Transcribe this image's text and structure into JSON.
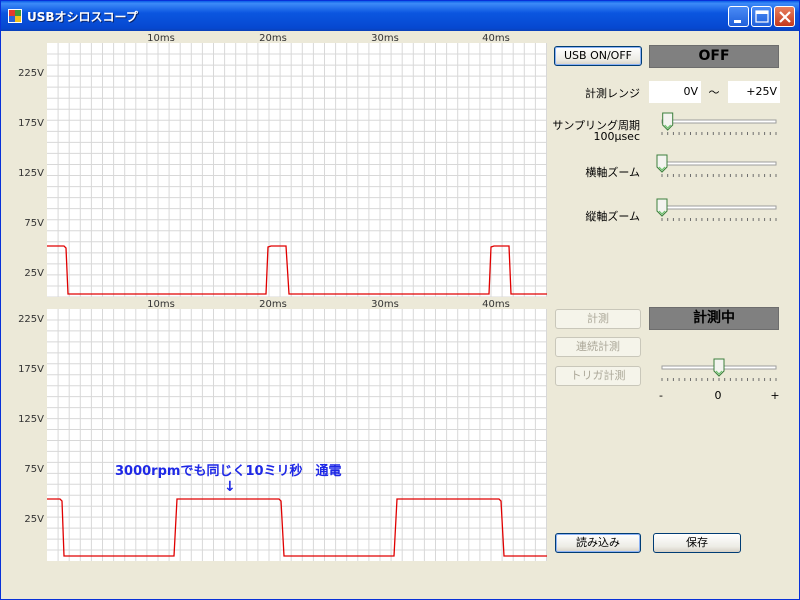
{
  "window": {
    "title": "USBオシロスコープ",
    "title_color": "#FFFFFF",
    "title_bar_color": "#0B56E0"
  },
  "scope_top": {
    "x_tick_labels": [
      "10ms",
      "20ms",
      "30ms",
      "40ms"
    ],
    "y_tick_labels": [
      "225V",
      "175V",
      "125V",
      "75V",
      "25V"
    ],
    "trace_color": "#E00000"
  },
  "scope_bottom": {
    "x_tick_labels": [
      "10ms",
      "20ms",
      "30ms",
      "40ms"
    ],
    "y_tick_labels": [
      "225V",
      "175V",
      "125V",
      "75V",
      "25V"
    ],
    "trace_color": "#E00000",
    "annotation": "3000rpmでも同じく10ミリ秒　通電",
    "annotation_arrow": "↓",
    "annotation_color": "#1E28E6"
  },
  "controls": {
    "usb_toggle_label": "USB ON/OFF",
    "usb_status": "OFF",
    "range_label": "計測レンジ",
    "range_min": "0V",
    "range_separator": "～",
    "range_max": "+25V",
    "sampling_label": "サンプリング周期",
    "sampling_value": "100μsec",
    "sampling_level": 0.05,
    "hzoom_label": "横軸ズーム",
    "hzoom_level": 0.0,
    "vzoom_label": "縦軸ズーム",
    "vzoom_level": 0.0,
    "measure_label": "計測",
    "continuous_label": "連続計測",
    "trigger_label": "トリガ計測",
    "measure_status": "計測中",
    "trigger_slider_min": "-",
    "trigger_slider_mid": "0",
    "trigger_slider_max": "+",
    "trigger_level": 0.5,
    "load_label": "読み込み",
    "save_label": "保存"
  }
}
